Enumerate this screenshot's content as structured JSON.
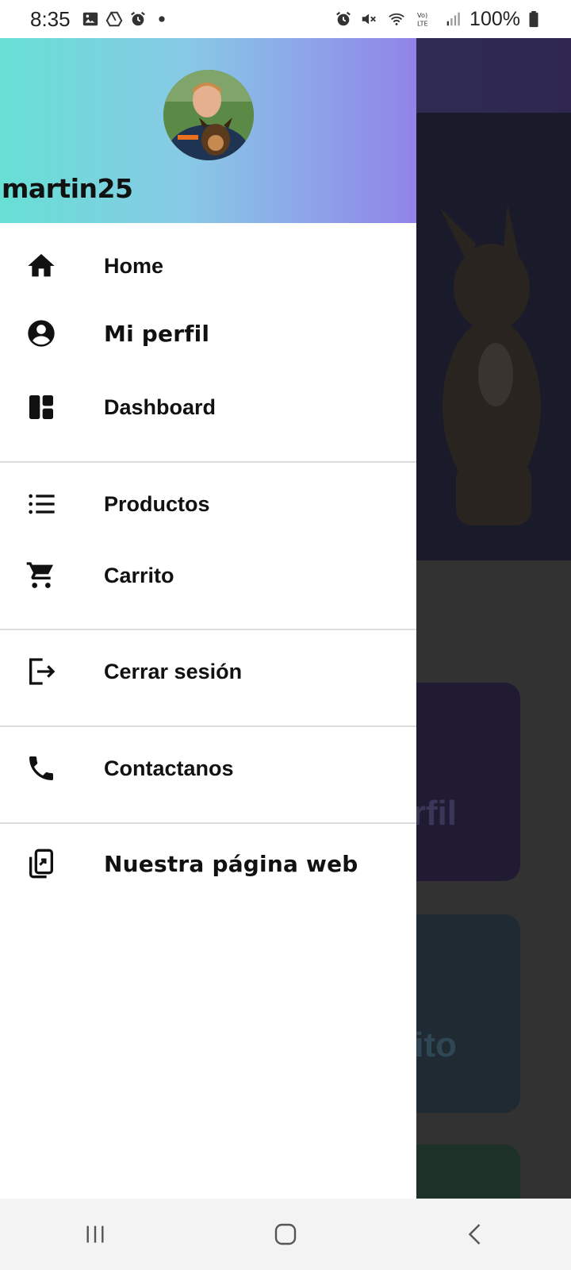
{
  "status_bar": {
    "time": "8:35",
    "battery": "100%",
    "left_icons": [
      "image-icon",
      "drive-icon",
      "alarm-icon",
      "dot-icon"
    ],
    "right_icons": [
      "alarm-icon",
      "mute-icon",
      "wifi-icon",
      "volte-icon",
      "signal-icon",
      "battery-icon"
    ]
  },
  "drawer": {
    "username": "martin25",
    "avatar": "profile-photo",
    "sections": [
      {
        "items": [
          {
            "label": "Home",
            "icon": "home-icon"
          },
          {
            "label": "Mi perfil",
            "icon": "account-icon"
          },
          {
            "label": "Dashboard",
            "icon": "dashboard-icon"
          }
        ]
      },
      {
        "items": [
          {
            "label": "Productos",
            "icon": "list-icon"
          },
          {
            "label": "Carrito",
            "icon": "cart-icon"
          }
        ]
      },
      {
        "items": [
          {
            "label": "Cerrar sesión",
            "icon": "logout-icon"
          }
        ]
      },
      {
        "items": [
          {
            "label": "Contactanos",
            "icon": "phone-icon"
          }
        ]
      },
      {
        "items": [
          {
            "label": "Nuestra página web",
            "icon": "website-icon"
          }
        ]
      }
    ]
  },
  "background": {
    "card_labels": [
      "rfil",
      "rito"
    ]
  },
  "nav_bar": {
    "buttons": [
      "recents-icon",
      "home-circle-icon",
      "back-icon"
    ]
  },
  "colors": {
    "header_gradient_start": "#66e0d4",
    "header_gradient_end": "#9183e9",
    "drawer_bg": "#ffffff",
    "text": "#111111"
  }
}
